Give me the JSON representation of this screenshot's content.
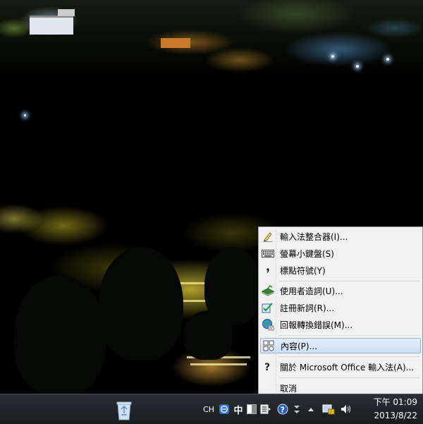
{
  "context_menu": {
    "items": [
      {
        "label": "輸入法整合器(I)...",
        "icon": "pencil-icon"
      },
      {
        "label": "螢幕小鍵盤(S)",
        "icon": "keyboard-icon"
      },
      {
        "label": "標點符號(Y)",
        "icon": "comma-icon"
      },
      {
        "label": "使用者造詞(U)...",
        "icon": "green-book-icon"
      },
      {
        "label": "註冊新詞(R)...",
        "icon": "register-word-icon"
      },
      {
        "label": "回報轉換錯誤(M)...",
        "icon": "globe-icon"
      },
      {
        "label": "內容(P)...",
        "icon": "properties-icon",
        "highlighted": true
      },
      {
        "label": "關於 Microsoft Office 輸入法(A)...",
        "icon": "help-icon"
      },
      {
        "label": "取消",
        "icon": ""
      }
    ]
  },
  "taskbar": {
    "recycle_bin_icon": "recycle-bin-icon",
    "tray": {
      "language": "CH",
      "input_mode": "中",
      "clock_time": "下午 01:09",
      "clock_date": "2013/8/22"
    }
  },
  "colors": {
    "menu_bg": "#f1f1f1",
    "menu_highlight": "#cfe0f5",
    "taskbar_bg": "#1a1c1f"
  }
}
